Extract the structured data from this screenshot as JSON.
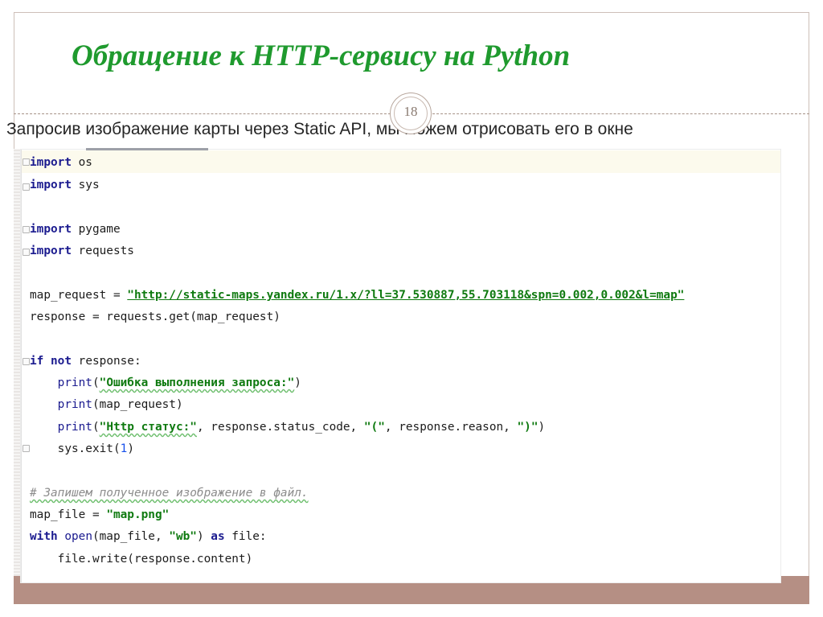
{
  "slide": {
    "title": "Обращение к HTTP-сервису на Python",
    "page_number": "18",
    "body_text": "Запросив изображение карты через Static API, мы можем отрисовать его в окне"
  },
  "code": {
    "line1": {
      "k": "import",
      "t": " os"
    },
    "line2": {
      "k": "import",
      "t": " sys"
    },
    "line3": {
      "k": "import",
      "t": " pygame"
    },
    "line4": {
      "k": "import",
      "t": " requests"
    },
    "line5": {
      "a": "map_request = ",
      "s": "\"http://static-maps.yandex.ru/1.x/?ll=37.530887,55.703118&spn=0.002,0.002&l=map\""
    },
    "line6": {
      "t": "response = requests.get(map_request)"
    },
    "line7": {
      "k1": "if",
      "k2": "not",
      "t": " response:"
    },
    "line8": {
      "b": "print",
      "p1": "(",
      "s": "\"Ошибка выполнения запроса:\"",
      "p2": ")"
    },
    "line9": {
      "b": "print",
      "t": "(map_request)"
    },
    "line10": {
      "b": "print",
      "p1": "(",
      "s1": "\"Http статус:\"",
      "m": ", response.status_code, ",
      "s2": "\"(\"",
      "m2": ", response.reason, ",
      "s3": "\")\"",
      "p2": ")"
    },
    "line11": {
      "a": "sys.exit(",
      "n": "1",
      "p": ")"
    },
    "line12": {
      "c": "# Запишем полученное изображение в файл."
    },
    "line13": {
      "a": "map_file = ",
      "s": "\"map.png\""
    },
    "line14": {
      "k1": "with",
      "b": "open",
      "a": "(map_file, ",
      "s": "\"wb\"",
      "p": ") ",
      "k2": "as",
      "t": " file:"
    },
    "line15": {
      "t": "file.write(response.content)"
    }
  },
  "colors": {
    "title": "#1f9a2e",
    "bottom_bar": "#b58f84",
    "keyword": "#1b1b8f",
    "string": "#0f7a10",
    "number": "#1750eb",
    "comment": "#8c8c8c"
  }
}
